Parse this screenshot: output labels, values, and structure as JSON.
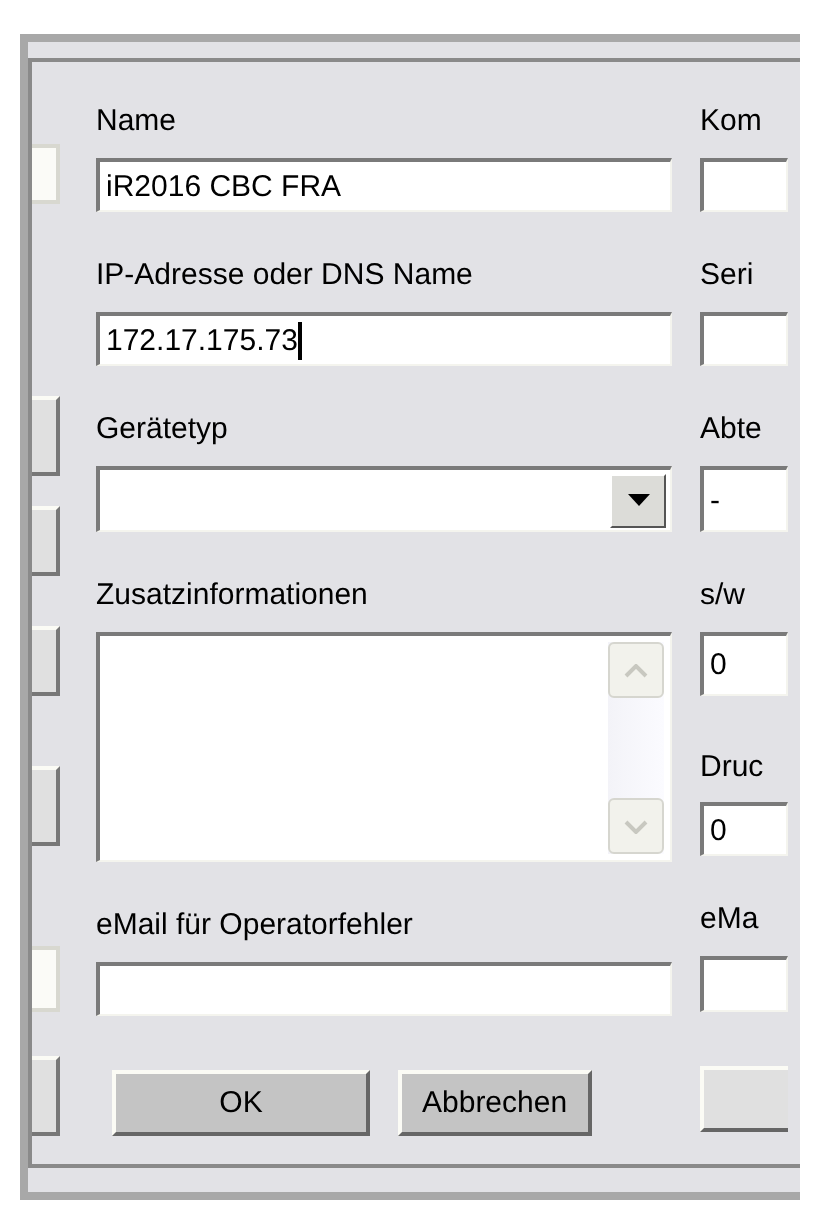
{
  "fields": [
    {
      "label": "Name",
      "kind": "text",
      "value": "iR2016 CBC FRA",
      "focused": false
    },
    {
      "label": "IP-Adresse oder DNS Name",
      "kind": "text",
      "value": "172.17.175.73",
      "focused": true
    },
    {
      "label": "Gerätetyp",
      "kind": "combo",
      "focused": false
    },
    {
      "label": "Zusatzinformationen",
      "kind": "memo",
      "focused": false
    },
    {
      "label": "eMail für Operatorfehler",
      "kind": "text",
      "focused": false
    }
  ],
  "right_fields": [
    {
      "label": "Kom"
    },
    {
      "label": "Seri"
    },
    {
      "label": "Abte",
      "value": "-"
    },
    {
      "label": "s/w",
      "value": "0"
    },
    {
      "label": "Druc",
      "value": "0"
    },
    {
      "label": "eMa"
    }
  ],
  "buttons": [
    "OK",
    "Abbrechen"
  ]
}
